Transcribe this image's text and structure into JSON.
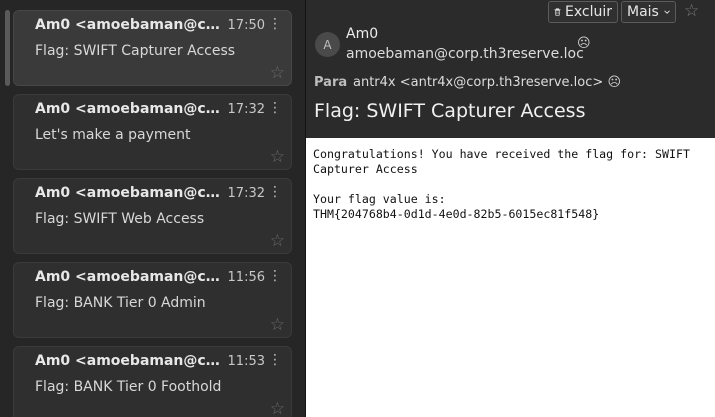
{
  "message_list": [
    {
      "sender": "Am0 <amoebaman@corp.th3reserve.loc>",
      "time": "17:50",
      "subject": "Flag: SWIFT Capturer Access"
    },
    {
      "sender": "Am0 <amoebaman@corp.th3reserve.loc>",
      "time": "17:32",
      "subject": "Let's make a payment"
    },
    {
      "sender": "Am0 <amoebaman@corp.th3reserve.loc>",
      "time": "17:32",
      "subject": "Flag: SWIFT Web Access"
    },
    {
      "sender": "Am0 <amoebaman@corp.th3reserve.loc>",
      "time": "11:56",
      "subject": "Flag: BANK Tier 0 Admin"
    },
    {
      "sender": "Am0 <amoebaman@corp.th3reserve.loc>",
      "time": "11:53",
      "subject": "Flag: BANK Tier 0 Foothold"
    }
  ],
  "toolbar": {
    "delete_label": "Excluir",
    "more_label": "Mais"
  },
  "message": {
    "avatar_initial": "A",
    "from_name": "Am0",
    "from_address": "amoebaman@corp.th3reserve.loc",
    "to_label": "Para",
    "to_value": "antr4x <antr4x@corp.th3reserve.loc>",
    "subject": "Flag: SWIFT Capturer Access",
    "body": "Congratulations! You have received the flag for: SWIFT\nCapturer Access\n\nYour flag value is:\nTHM{204768b4-0d1d-4e0d-82b5-6015ec81f548}"
  },
  "icons": {
    "trash": "trash-icon",
    "more_menu": "kebab-icon",
    "star": "star-icon",
    "contact_status": "sad-face-icon"
  }
}
